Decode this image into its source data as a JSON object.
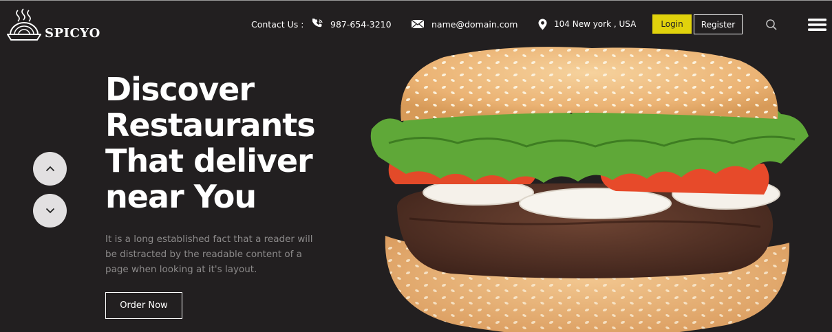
{
  "brand": {
    "name": "SPICYO",
    "logo_icon": "steaming-bowl-icon"
  },
  "header": {
    "contact_label": "Contact Us :",
    "phone": {
      "icon": "phone-icon",
      "text": "987-654-3210"
    },
    "email": {
      "icon": "mail-icon",
      "text": "name@domain.com"
    },
    "address": {
      "icon": "location-pin-icon",
      "text": "104 New york , USA"
    },
    "login_label": "Login",
    "register_label": "Register",
    "search_icon": "search-icon",
    "menu_icon": "hamburger-menu-icon"
  },
  "hero": {
    "title_lines": [
      "Discover",
      "Restaurants",
      "That deliver",
      "near You"
    ],
    "description": "It is a long established fact that a reader will be distracted by the readable content of a page when looking at it's layout.",
    "cta_label": "Order Now",
    "image": "burger-image"
  },
  "slider": {
    "prev_icon": "chevron-up-icon",
    "next_icon": "chevron-down-icon"
  },
  "colors": {
    "background": "#221f20",
    "accent": "#e1d20c",
    "muted_text": "#8c8a8a"
  }
}
